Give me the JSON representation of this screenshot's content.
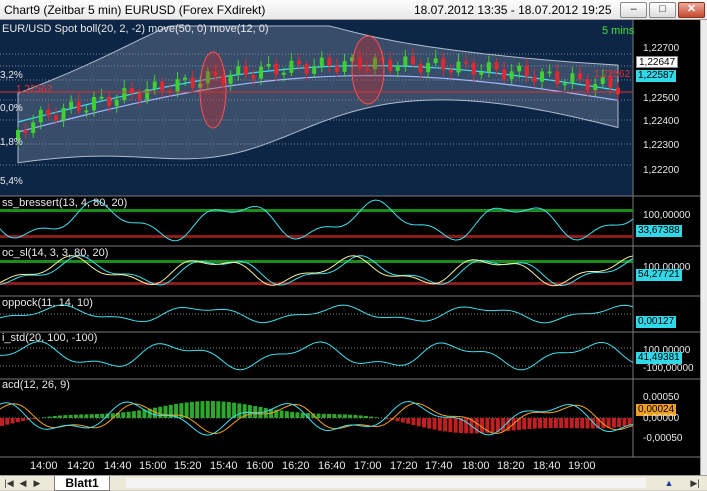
{
  "window": {
    "title": "Chart9 (Zeitbar 5 min)  EURUSD  (Forex FXdirekt)",
    "date_range": "18.07.2012 13:35 - 18.07.2012 19:25",
    "minimize_label": "–",
    "maximize_label": "□",
    "close_label": "✕"
  },
  "price_panel": {
    "title": "EUR/USD  Spot  boll(20, 2, -2)  move(50, 0)  move(12, 0)",
    "interval": "5 mins",
    "pct_labels": [
      "3,2%",
      "0,0%",
      "1,8%",
      "5,4%"
    ],
    "left_price_label": "1,22562",
    "axis_labels": [
      "1,22700",
      "1,22500",
      "1,22400",
      "1,22300",
      "1,22200"
    ],
    "last_price": "1,22647",
    "ma_value": "1,22587",
    "red_value": "1,22562"
  },
  "indicators": [
    {
      "title": "ss_bressert(13, 4, 80, 20)",
      "axis": [
        "100,00000"
      ],
      "value": "33,67388",
      "value_color": "#30d8e8"
    },
    {
      "title": "oc_sl(14, 3, 3, 80, 20)",
      "axis": [
        "100,00000"
      ],
      "value": "54,27721",
      "value_color": "#30d8e8"
    },
    {
      "title": "oppock(11, 14, 10)",
      "axis": [],
      "value": "0,00127",
      "value_color": "#30d8e8"
    },
    {
      "title": "i_std(20, 100, -100)",
      "axis": [
        "100,00000",
        "-100,00000"
      ],
      "value": "41,49381",
      "value_color": "#30d8e8"
    },
    {
      "title": "acd(12, 26, 9)",
      "axis": [
        "0,00050",
        "0,00000",
        "-0,00050"
      ],
      "value": "0,00024",
      "value_color": "#f0a020"
    }
  ],
  "time_axis": [
    "14:00",
    "14:20",
    "14:40",
    "15:00",
    "15:20",
    "15:40",
    "16:00",
    "16:20",
    "16:40",
    "17:00",
    "17:20",
    "17:40",
    "18:00",
    "18:20",
    "18:40",
    "19:00"
  ],
  "bottom_bar": {
    "sheet_tab": "Blatt1",
    "nav_first": "|◀",
    "nav_prev": "◀",
    "nav_next": "▶",
    "nav_last": "▶|"
  },
  "colors": {
    "background": "#000000",
    "price_bg": "#0d2645",
    "bollinger_band": "#8a98b0",
    "up_candle": "#40d030",
    "down_candle": "#e02830",
    "ma_fast": "#40e0f0",
    "macd_hist": "#2da82d"
  }
}
